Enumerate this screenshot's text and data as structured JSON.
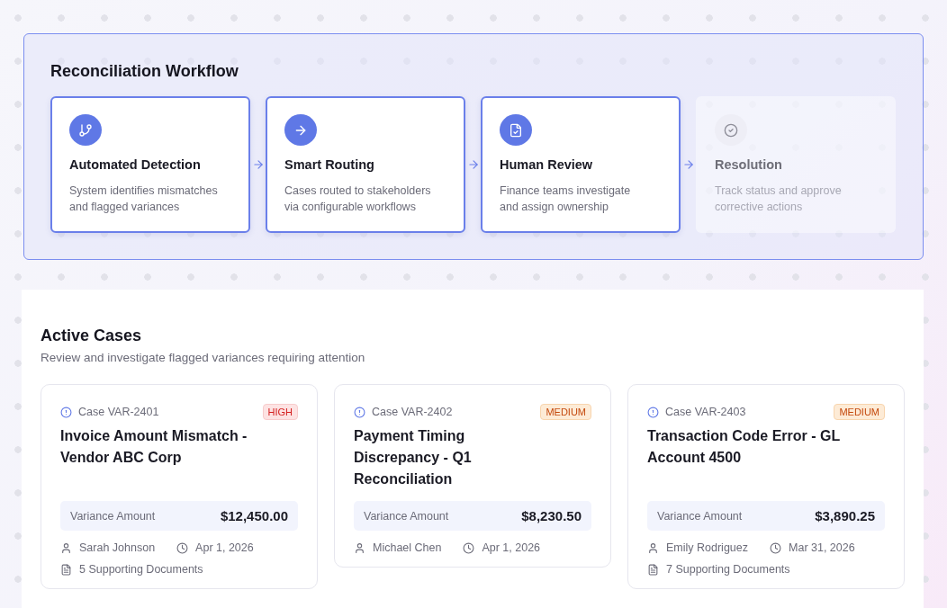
{
  "workflow": {
    "title": "Reconciliation Workflow",
    "steps": [
      {
        "title": "Automated Detection",
        "description": "System identifies mismatches and flagged variances",
        "active": true
      },
      {
        "title": "Smart Routing",
        "description": "Cases routed to stakeholders via configurable workflows",
        "active": true
      },
      {
        "title": "Human Review",
        "description": "Finance teams investigate and assign ownership",
        "active": true
      },
      {
        "title": "Resolution",
        "description": "Track status and approve corrective actions",
        "active": false
      }
    ]
  },
  "cases": {
    "title": "Active Cases",
    "subtitle": "Review and investigate flagged variances requiring attention",
    "items": [
      {
        "case_id": "Case VAR-2401",
        "severity": "HIGH",
        "kind": "high",
        "title": "Invoice Amount Mismatch - Vendor ABC Corp",
        "amount_label": "Variance Amount",
        "amount": "$12,450.00",
        "assignee": "Sarah Johnson",
        "date": "Apr 1, 2026",
        "documents": "5 Supporting Documents"
      },
      {
        "case_id": "Case VAR-2402",
        "severity": "MEDIUM",
        "kind": "medium",
        "title": "Payment Timing Discrepancy - Q1 Reconciliation",
        "amount_label": "Variance Amount",
        "amount": "$8,230.50",
        "assignee": "Michael Chen",
        "date": "Apr 1, 2026"
      },
      {
        "case_id": "Case VAR-2403",
        "severity": "MEDIUM",
        "kind": "medium",
        "title": "Transaction Code Error - GL Account 4500",
        "amount_label": "Variance Amount",
        "amount": "$3,890.25",
        "assignee": "Emily Rodriguez",
        "date": "Mar 31, 2026",
        "documents": "7 Supporting Documents"
      }
    ]
  }
}
